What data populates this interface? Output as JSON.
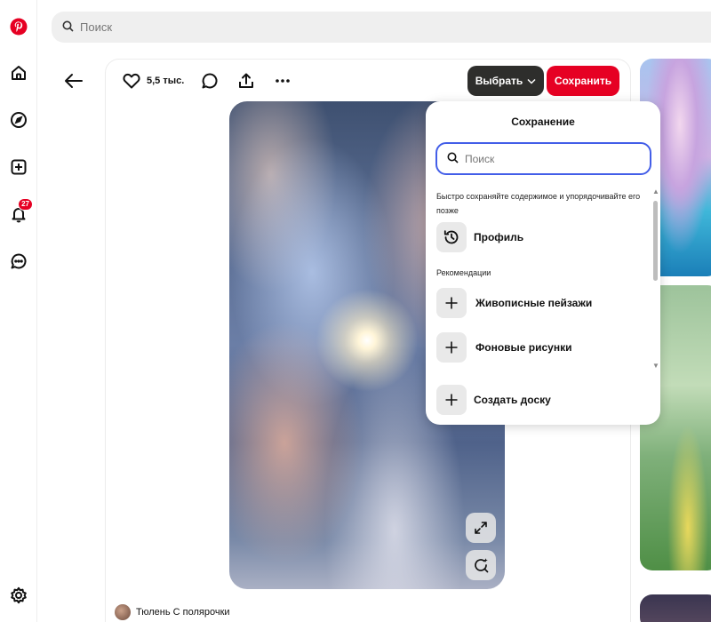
{
  "sidebar": {
    "notification_count": "27"
  },
  "header": {
    "search_placeholder": "Поиск"
  },
  "pin": {
    "likes": "5,5 тыс.",
    "select_label": "Выбрать",
    "save_label": "Сохранить",
    "author": "Тюлень С полярочки"
  },
  "save_popup": {
    "title": "Сохранение",
    "search_placeholder": "Поиск",
    "quick_save_hint": "Быстро сохраняйте содержимое и упорядочивайте его позже",
    "profile_label": "Профиль",
    "recommendations_label": "Рекомендации",
    "boards": [
      {
        "label": "Живописные пейзажи"
      },
      {
        "label": "Фоновые рисунки"
      }
    ],
    "create_board_label": "Создать доску"
  },
  "colors": {
    "brand_red": "#e60023",
    "dark_button": "#2e2e2c",
    "focus_blue": "#435ee8"
  },
  "icons": [
    "pinterest-logo-icon",
    "home-icon",
    "explore-icon",
    "create-icon",
    "bell-icon",
    "messages-icon",
    "settings-icon",
    "search-icon",
    "back-arrow-icon",
    "heart-icon",
    "comment-icon",
    "share-icon",
    "more-icon",
    "chevron-down-icon",
    "expand-icon",
    "visual-search-icon",
    "history-icon",
    "plus-icon"
  ]
}
